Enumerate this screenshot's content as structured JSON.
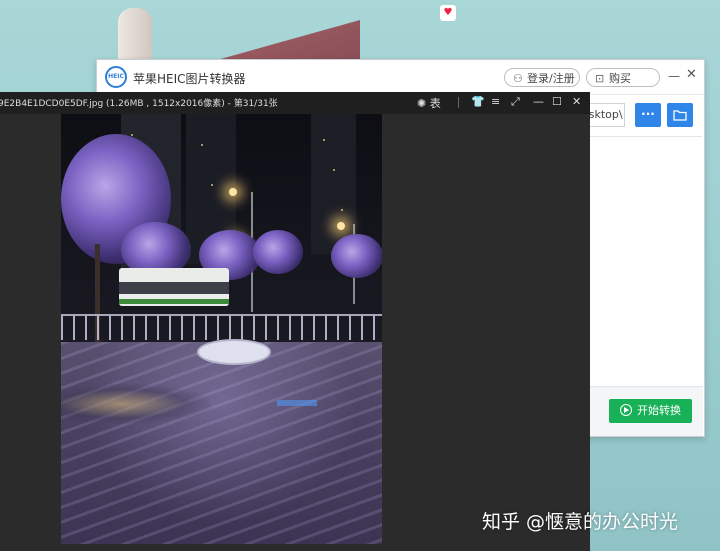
{
  "converter": {
    "logo_text": "HEIC",
    "title": "苹果HEIC图片转换器",
    "login_label": "登录/注册",
    "buy_label": "购买",
    "min_glyph": "—",
    "close_glyph": "✕",
    "output_path": "esktop\\",
    "more_label": "···",
    "start_label": "开始转换",
    "icons": [
      "user-icon",
      "cart-icon",
      "folder-icon",
      "play-icon"
    ],
    "accent_color": "#2f86e8",
    "start_color": "#18b157"
  },
  "viewer": {
    "file_info": "9E2B4E1DCD0E5DF.jpg (1.26MB , 1512x2016像素) - 第31/31张",
    "controls": {
      "theme_label": "表",
      "shirt_glyph": "👕",
      "menu_glyph": "≡",
      "fullscreen_glyph": "⤢",
      "minimize_glyph": "—",
      "maximize_glyph": "☐",
      "close_glyph": "✕"
    },
    "photo_description_icon": "photo"
  },
  "watermark": "知乎 @惬意的办公时光"
}
